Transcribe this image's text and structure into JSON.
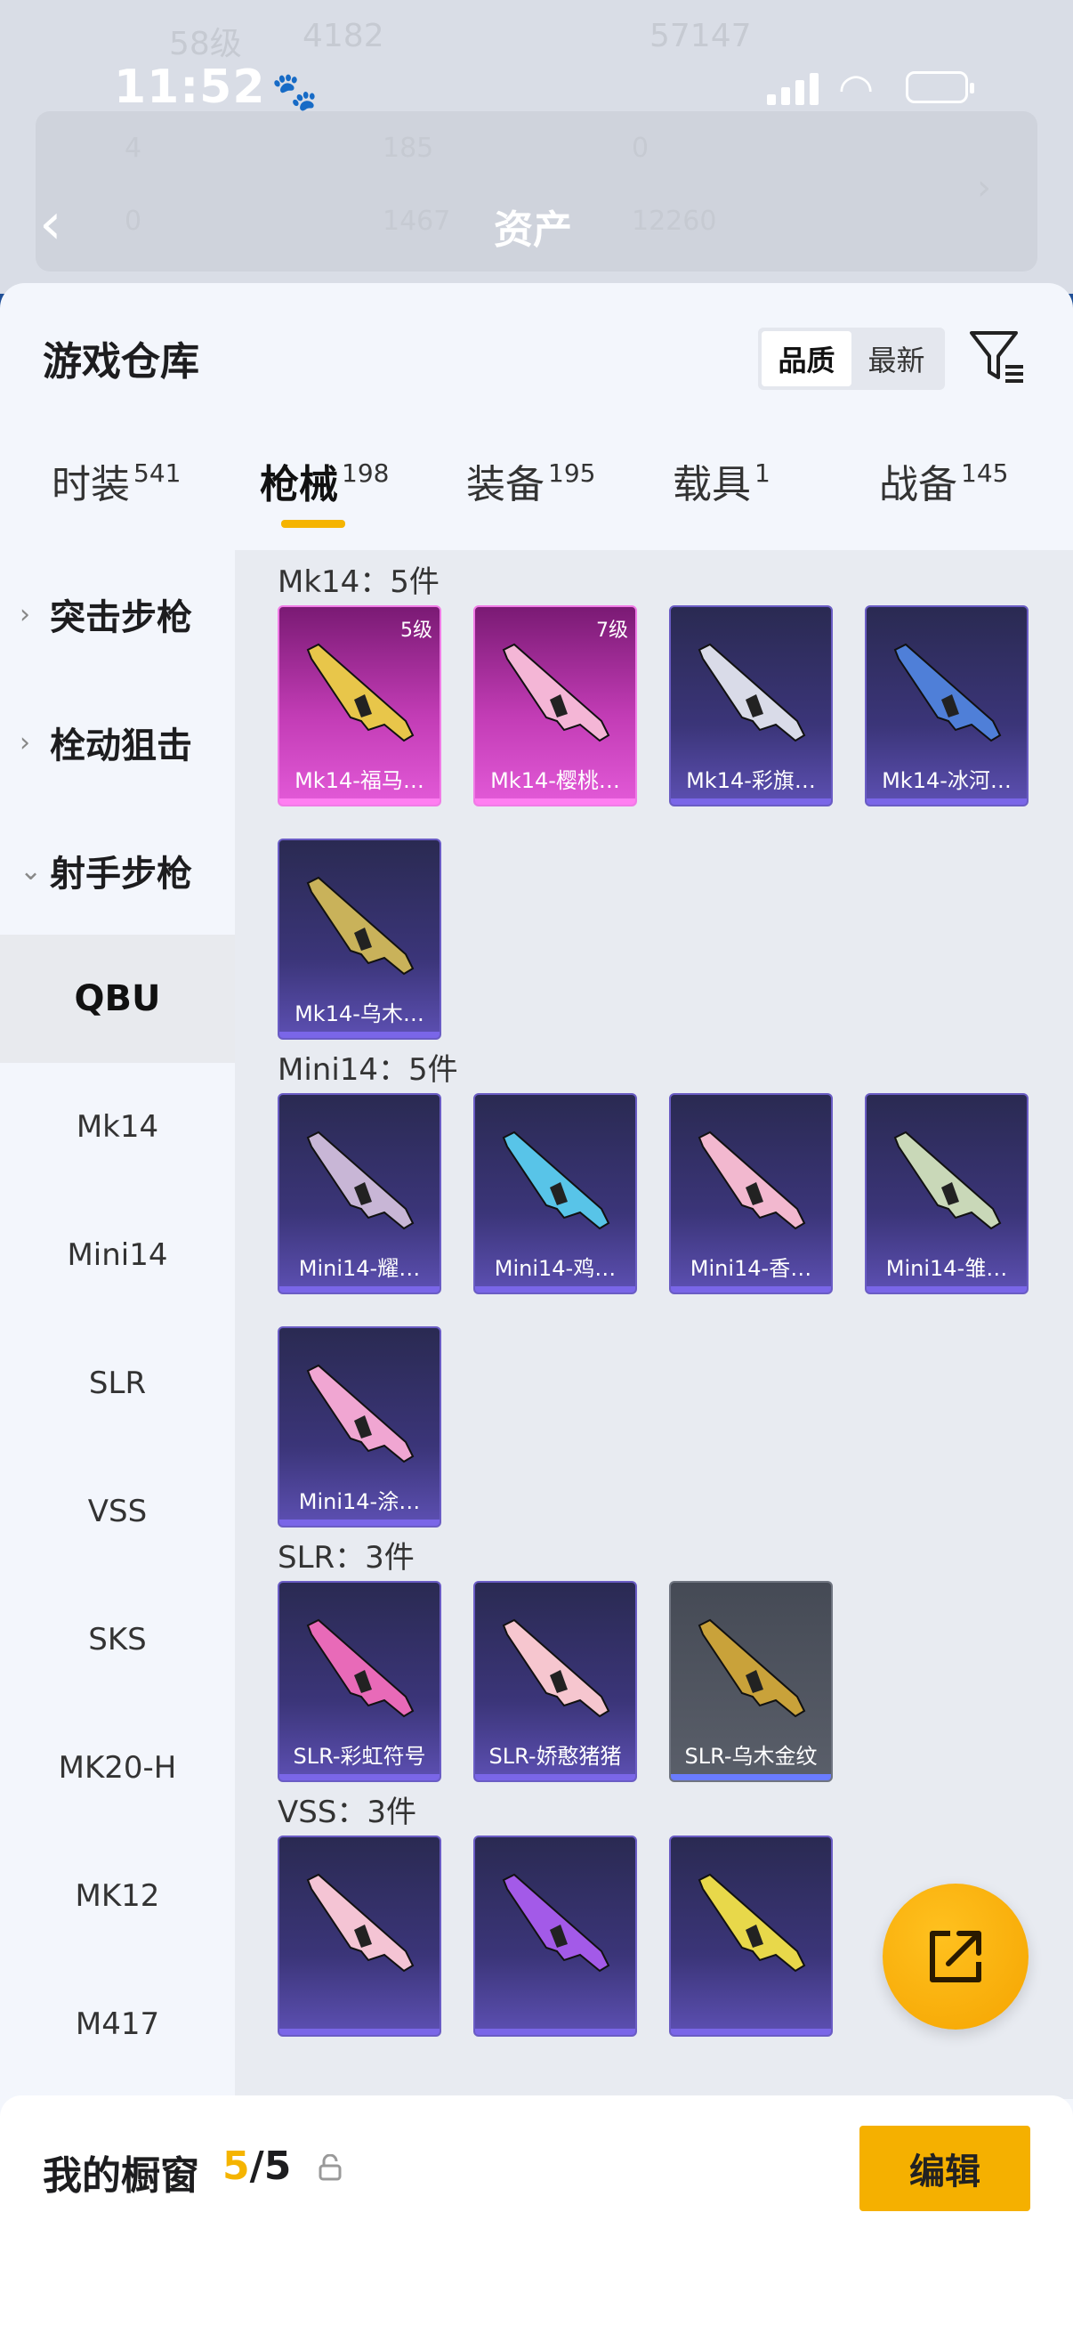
{
  "status": {
    "time": "11:52"
  },
  "background": {
    "level": "58级",
    "stat_a": "4182",
    "stat_b": "57147",
    "row2": [
      "4",
      "185",
      "0"
    ],
    "row3": [
      "0",
      "1467",
      "12260"
    ],
    "asset_title": "资产"
  },
  "sheet": {
    "title": "游戏仓库",
    "sort": [
      "品质",
      "最新"
    ],
    "sort_active": 0
  },
  "tabs": [
    {
      "label": "时装",
      "count": "541"
    },
    {
      "label": "枪械",
      "count": "198"
    },
    {
      "label": "装备",
      "count": "195"
    },
    {
      "label": "载具",
      "count": "1"
    },
    {
      "label": "战备",
      "count": "145"
    }
  ],
  "active_tab": 1,
  "categories": [
    {
      "label": "突击步枪",
      "expanded": false
    },
    {
      "label": "栓动狙击",
      "expanded": false
    },
    {
      "label": "射手步枪",
      "expanded": true
    }
  ],
  "subcategories": [
    "QBU",
    "Mk14",
    "Mini14",
    "SLR",
    "VSS",
    "SKS",
    "MK20-H",
    "MK12",
    "M417"
  ],
  "active_sub": 0,
  "groups": [
    {
      "title": "Mk14：5件",
      "items": [
        {
          "name": "Mk14-福马…",
          "level": "5级",
          "rarity": "pink",
          "gun": "#e8c64a"
        },
        {
          "name": "Mk14-樱桃…",
          "level": "7级",
          "rarity": "pink",
          "gun": "#f4b6d6"
        },
        {
          "name": "Mk14-彩旗…",
          "rarity": "purple",
          "gun": "#d9dbe8"
        },
        {
          "name": "Mk14-冰河…",
          "rarity": "purple",
          "gun": "#4f7fd8"
        },
        {
          "name": "Mk14-乌木…",
          "rarity": "purple",
          "gun": "#c9b25a"
        }
      ]
    },
    {
      "title": "Mini14：5件",
      "items": [
        {
          "name": "Mini14-耀…",
          "rarity": "purple",
          "gun": "#c8b6d6"
        },
        {
          "name": "Mini14-鸡…",
          "rarity": "purple",
          "gun": "#58c4e8"
        },
        {
          "name": "Mini14-香…",
          "rarity": "purple",
          "gun": "#f2b8cf"
        },
        {
          "name": "Mini14-雏…",
          "rarity": "purple",
          "gun": "#c9d8b8"
        },
        {
          "name": "Mini14-涂…",
          "rarity": "purple",
          "gun": "#f0a6d2"
        }
      ]
    },
    {
      "title": "SLR：3件",
      "items": [
        {
          "name": "SLR-彩虹符号",
          "rarity": "purple",
          "gun": "#e86ab8"
        },
        {
          "name": "SLR-娇憨猪猪",
          "rarity": "purple",
          "gun": "#f6c6cf"
        },
        {
          "name": "SLR-乌木金纹",
          "rarity": "gray",
          "gun": "#c9a23a"
        }
      ]
    },
    {
      "title": "VSS：3件",
      "items": [
        {
          "name": "",
          "rarity": "purple",
          "gun": "#f4c4d4"
        },
        {
          "name": "",
          "rarity": "purple",
          "gun": "#a35ae8"
        },
        {
          "name": "",
          "rarity": "purple",
          "gun": "#e8d84a"
        }
      ]
    }
  ],
  "bottom": {
    "label": "我的橱窗",
    "current": "5",
    "total": "/5",
    "edit": "编辑"
  },
  "colors": {
    "accent": "#f5b400",
    "purple_rarity": "#6a5cc4",
    "pink_rarity": "#e35ad8"
  }
}
